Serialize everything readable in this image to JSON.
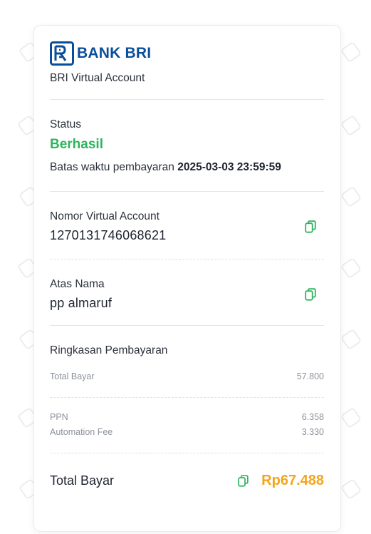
{
  "bank": {
    "logo_text": "BANK BRI",
    "subtitle": "BRI Virtual Account",
    "brand_color": "#0a4d9b"
  },
  "status": {
    "label": "Status",
    "value": "Berhasil",
    "value_color": "#2db55d",
    "deadline_label": "Batas waktu pembayaran",
    "deadline_value": "2025-03-03 23:59:59"
  },
  "va": {
    "label": "Nomor Virtual Account",
    "value": "1270131746068621",
    "copy_icon": "copy-icon"
  },
  "holder": {
    "label": "Atas Nama",
    "value": "pp almaruf",
    "copy_icon": "copy-icon"
  },
  "summary": {
    "title": "Ringkasan Pembayaran",
    "total_bayar_label": "Total Bayar",
    "total_bayar_value": "57.800",
    "ppn_label": "PPN",
    "ppn_value": "6.358",
    "fee_label": "Automation Fee",
    "fee_value": "3.330"
  },
  "total": {
    "label": "Total Bayar",
    "amount": "Rp67.488",
    "amount_color": "#f4a51c",
    "copy_icon": "copy-icon"
  }
}
